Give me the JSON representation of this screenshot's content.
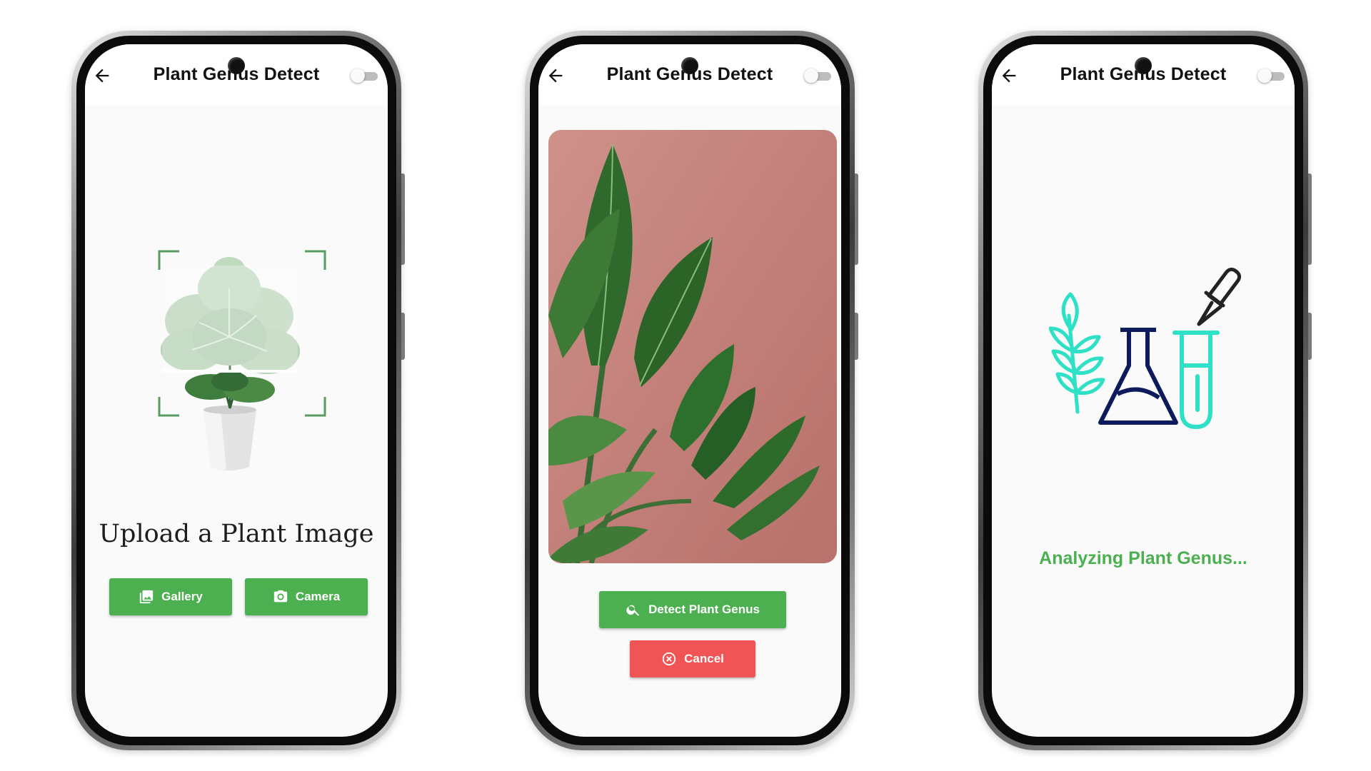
{
  "app": {
    "title": "Plant Genus Detect"
  },
  "screens": {
    "upload": {
      "heading": "Upload a Plant Image",
      "gallery_button": {
        "label": "Gallery",
        "icon": "photo-library-icon"
      },
      "camera_button": {
        "label": "Camera",
        "icon": "camera-icon"
      }
    },
    "preview": {
      "detect_button": {
        "label": "Detect Plant Genus",
        "icon": "search-icon"
      },
      "cancel_button": {
        "label": "Cancel",
        "icon": "cancel-circle-icon"
      }
    },
    "analyzing": {
      "status": "Analyzing Plant Genus..."
    }
  },
  "theme": {
    "primary": "#4caf50",
    "danger": "#f05454",
    "navy": "#0d1b5c",
    "teal": "#2ee0c6",
    "photo_background": "#c9857f"
  },
  "icons": {
    "back": "arrow-back-icon",
    "theme_toggle": "dark-mode-switch"
  }
}
